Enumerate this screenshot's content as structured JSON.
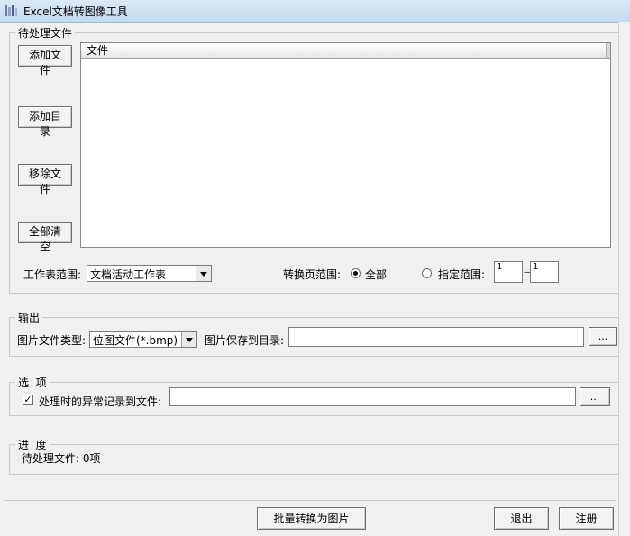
{
  "window": {
    "title": "Excel文档转图像工具"
  },
  "pending": {
    "group_label": "待处理文件",
    "buttons": {
      "add_file": "添加文件",
      "add_dir": "添加目录",
      "remove_file": "移除文件",
      "clear_all": "全部清空"
    },
    "list_header": "文件",
    "sheet_range_label": "工作表范围:",
    "sheet_range_value": "文档活动工作表",
    "page_range_label": "转换页范围:",
    "radio_all": "全部",
    "radio_specified": "指定范围:",
    "range_from": "1",
    "range_dash": "—",
    "range_to": "1"
  },
  "output": {
    "group_label": "输出",
    "type_label": "图片文件类型:",
    "type_value": "位图文件(*.bmp)",
    "dir_label": "图片保存到目录:",
    "dir_value": "",
    "browse_label": "..."
  },
  "options": {
    "group_label": "选  项",
    "log_label": "处理时的异常记录到文件:",
    "log_checked": true,
    "check_mark": "✓",
    "log_value": "",
    "browse_label": "..."
  },
  "progress": {
    "group_label": "进  度",
    "status_text": "待处理文件: 0项"
  },
  "footer": {
    "convert_label": "批量转换为图片",
    "exit_label": "退出",
    "register_label": "注册"
  }
}
